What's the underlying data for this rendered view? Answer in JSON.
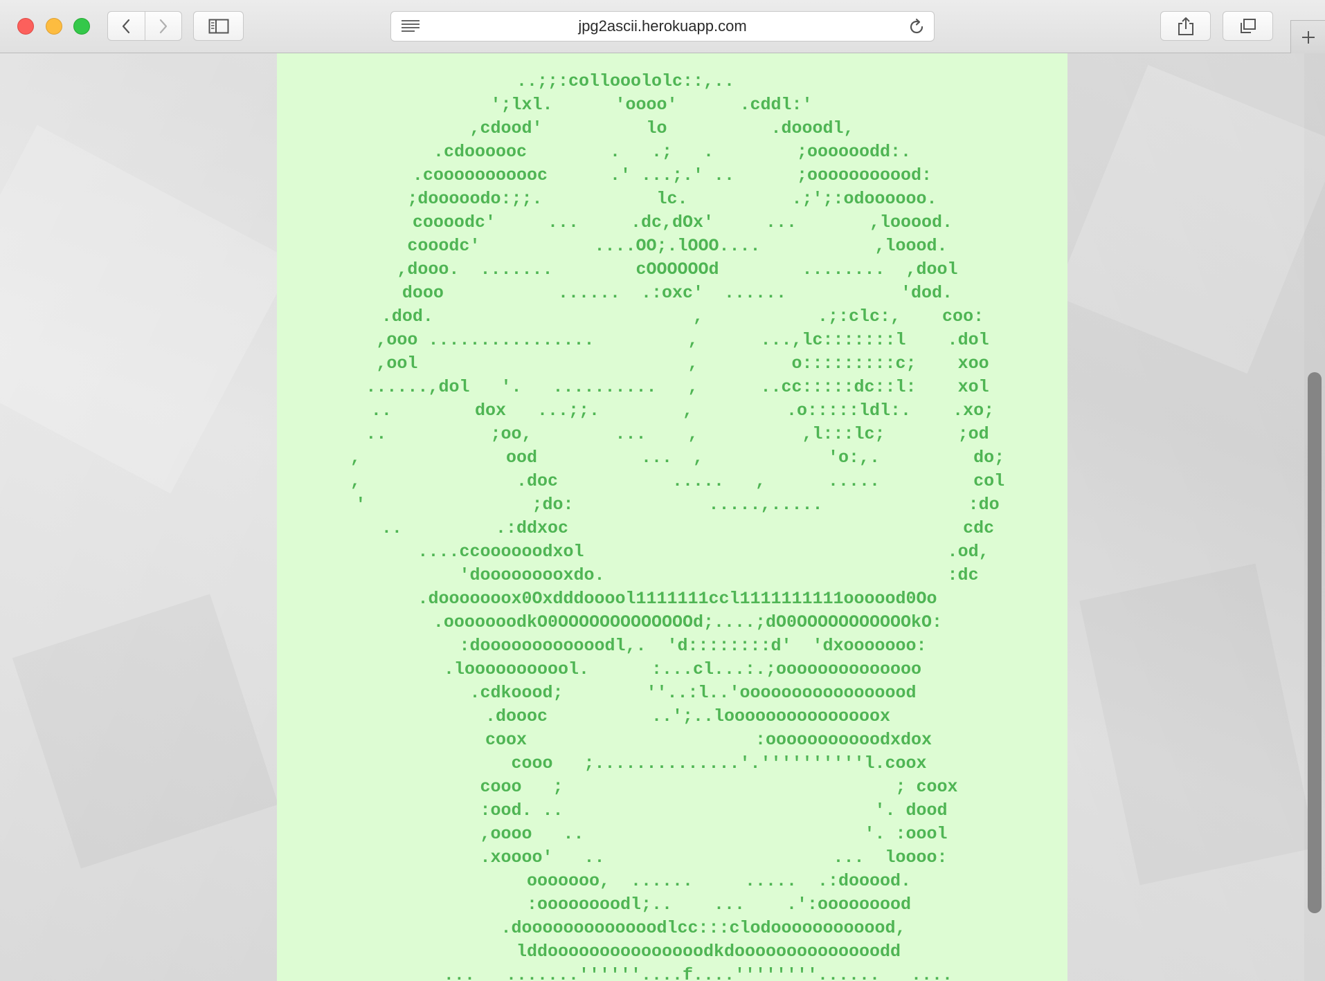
{
  "browser": {
    "url": "jpg2ascii.herokuapp.com",
    "buttons": {
      "back": "chevron-left-icon",
      "forward": "chevron-right-icon",
      "sidebar": "sidebar-icon",
      "reader": "reader-lines-icon",
      "reload": "reload-icon",
      "share": "share-icon",
      "tabs": "tabs-overview-icon",
      "new_tab": "plus-icon"
    }
  },
  "ascii_art": {
    "color": "#4fb554",
    "background": "#ddfcd3",
    "text": "..;;:collooololc::,..         \n  ';lxl.      'oooo'      .cddl:'      \n ,cdood'          lo          .dooodl,   \n  .cdoooooc        .   .;   .        ;oooooodd:.  \n .cooooooooooc      .' ...;.' ..      ;ooooooooood: \n ;dooooodo:;;.           lc.          .;';:odoooooo. \n  coooodc'     ...     .dc,dOx'     ...       ,looood.\n cooodc'           ....OO;.lOOO....           ,loood.\n ,dooo.  .......        cOOOOOOd        ........  ,dool\n dooo           ......  .:oxc'  ......           'dod.\n  .dod.                         ,           .;:clc:,    coo:\n  ,ooo ................         ,      ...,lc:::::::l    .dol\n  ,ool                          ,         o:::::::::c;    xoo\n ......,dol   '.   ..........   ,      ..cc:::::dc::l:    xol\n  ..        dox   ...;;.        ,         .o:::::ldl:.    .xo;\n ..          ;oo,        ...    ,          ,l:::lc;       ;od\n ,              ood          ...  ,            'o:,.         do;\n ,               .doc           .....   ,      .....         col\n '                ;do:             .....,.....              :do\n   ..         .:ddxoc                                      cdc\n      ....ccoooooodxol                                   .od,\n         'dooooooooxdo.                                 :dc\n .dooooooox0Oxdddooool1111111ccl1111111111oooood0Oo\n   .ooooooodkO0OOOOOOOOOOOOOd;....;dO0OOOOOOOOOOOkO:\n    :doooooooooooodl,.  'd::::::::d'  'dxooooooo:\n  .looooooooool.      :...cl...:.;oooooooooooooo\n    .cdkoood;        ''..:l..'ooooooooooooooood\n   .doooc          ..';..looooooooooooooox\n       coox                      :ooooooooooodxdox\n         cooo   ;..............'.''''''''''l.coox\n         cooo   ;                                ; coox\n        :ood. ..                              '. dood\n        ,oooo   ..                           '. :oool\n        .xoooo'   ..                      ...  loooo:\n         ooooooo,  ......     .....  .:dooood.\n         :oooooooodl;..    ...    .':ooooooood\n      .dooooooooooooodlcc:::clodoooooooooood,\n       lddooooooooooooooodkdoooooooooooooodd\n     ...   .......''''''....f....''''''''......   ...."
  }
}
